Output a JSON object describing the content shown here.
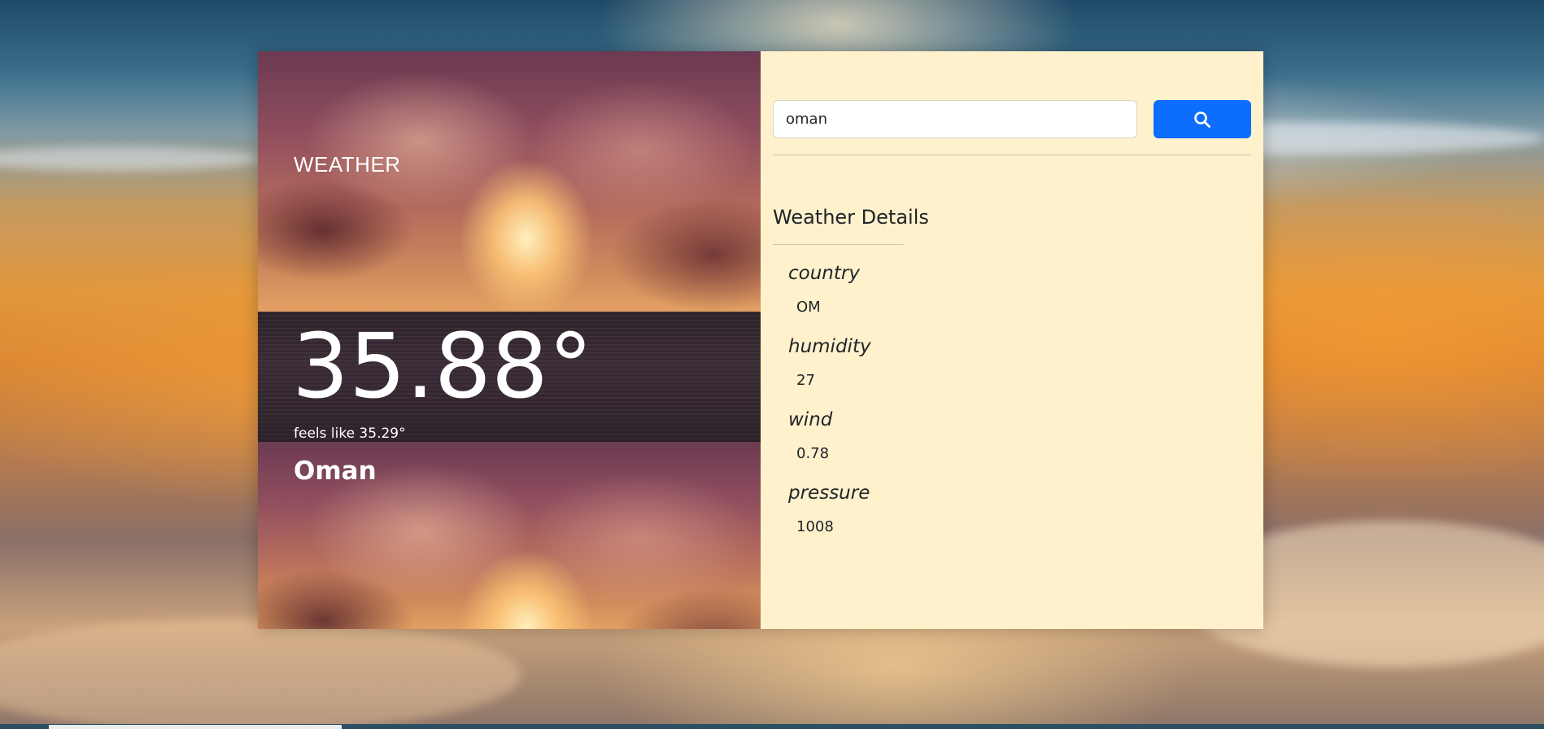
{
  "app": {
    "title": "WEATHER"
  },
  "current": {
    "temperature": "35.88°",
    "feels_like": "feels like 35.29°",
    "city": "Oman"
  },
  "search": {
    "value": "oman",
    "button_icon": "search-icon",
    "button_color": "#0d6efd"
  },
  "details": {
    "heading": "Weather Details",
    "items": [
      {
        "label": "country",
        "value": "OM"
      },
      {
        "label": "humidity",
        "value": "27"
      },
      {
        "label": "wind",
        "value": "0.78"
      },
      {
        "label": "pressure",
        "value": "1008"
      }
    ]
  },
  "colors": {
    "details_panel": "#fef1cc",
    "text": "#212529",
    "accent": "#0d6efd"
  }
}
